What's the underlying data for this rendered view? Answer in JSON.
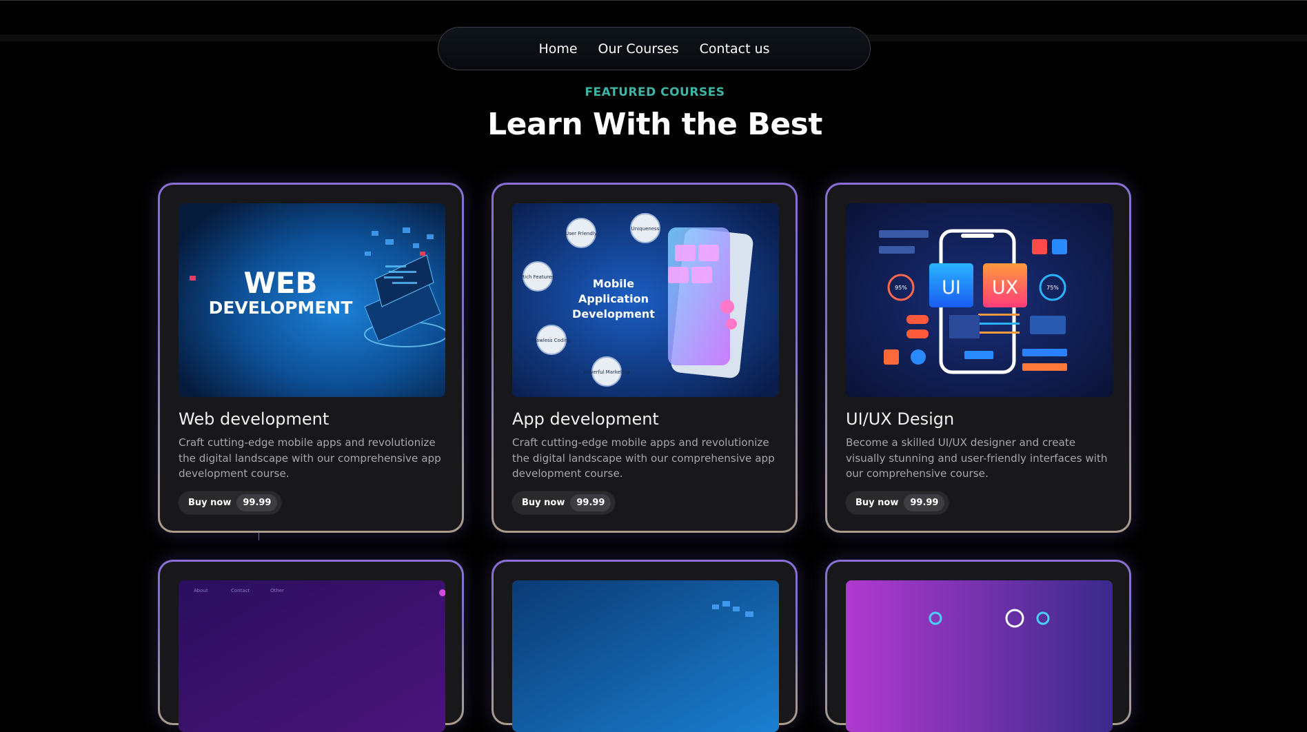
{
  "nav": {
    "items": [
      "Home",
      "Our Courses",
      "Contact us"
    ]
  },
  "hero": {
    "eyebrow": "FEATURED COURSES",
    "title": "Learn With the Best"
  },
  "buy_label": "Buy now",
  "courses": [
    {
      "title": "Web development",
      "description": "Craft cutting-edge mobile apps and revolutionize the digital landscape with our comprehensive app development course.",
      "price": "99.99",
      "image_text": [
        "WEB",
        "DEVELOPMENT"
      ]
    },
    {
      "title": "App development",
      "description": "Craft cutting-edge mobile apps and revolutionize the digital landscape with our comprehensive app development course.",
      "price": "99.99",
      "image_text": [
        "Mobile",
        "Application",
        "Development"
      ],
      "image_bubbles": [
        "User Friendly",
        "Uniqueness",
        "Rich Features",
        "Flawless Coding",
        "Powerful Marketing"
      ]
    },
    {
      "title": "UI/UX Design",
      "description": "Become a skilled UI/UX designer and create visually stunning and user-friendly interfaces with our comprehensive course.",
      "price": "99.99",
      "image_text": [
        "UI",
        "UX",
        "95%",
        "75%"
      ]
    }
  ],
  "second_row_image_text": [
    "About",
    "Contact",
    "Other"
  ],
  "colors": {
    "accent": "#3eb6a6",
    "card_bg": "#18181b",
    "border_top": "#8a6fd6"
  }
}
